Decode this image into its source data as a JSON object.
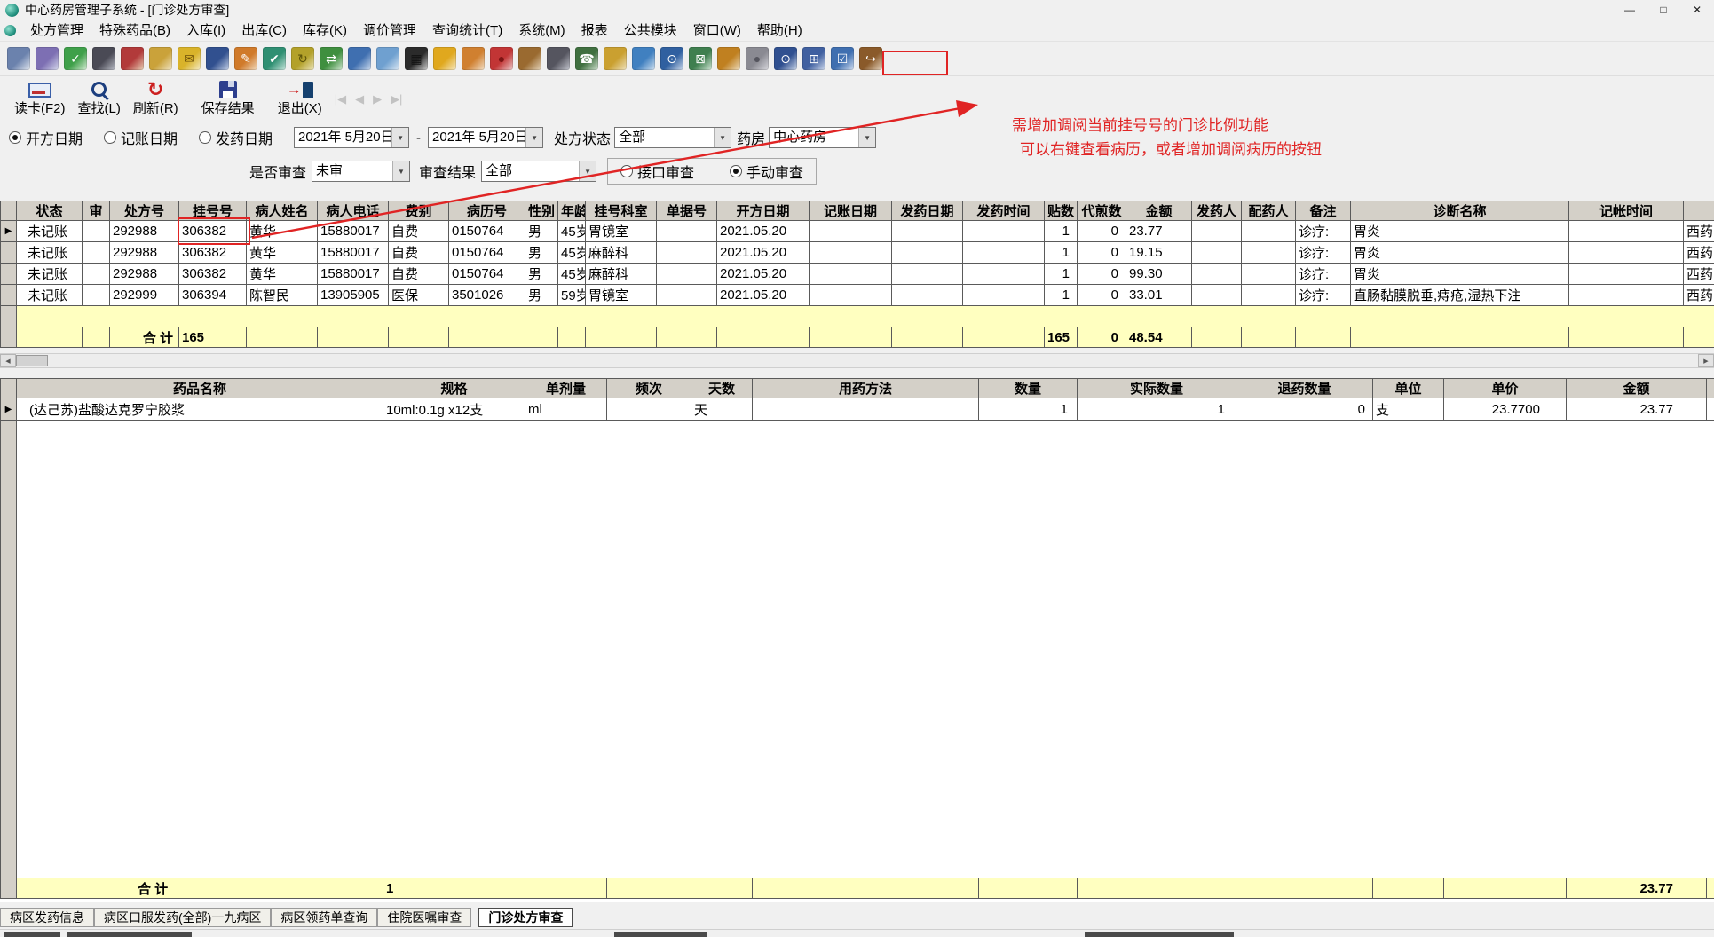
{
  "window": {
    "title": "中心药房管理子系统 - [门诊处方审查]",
    "controls": [
      {
        "name": "minimize-button",
        "glyph": "—"
      },
      {
        "name": "maximize-button",
        "glyph": "□"
      },
      {
        "name": "close-button",
        "glyph": "✕"
      }
    ]
  },
  "menu_items": [
    "处方管理",
    "特殊药品(B)",
    "入库(I)",
    "出库(C)",
    "库存(K)",
    "调价管理",
    "查询统计(T)",
    "系统(M)",
    "报表",
    "公共模块",
    "窗口(W)",
    "帮助(H)"
  ],
  "toolbar_icons": [
    {
      "name": "print-icon",
      "c1": "#6b82ad",
      "c2": "#e3e8f0",
      "g": ""
    },
    {
      "name": "print-preview-icon",
      "c1": "#7d6fb3",
      "c2": "#d6d9ec",
      "g": ""
    },
    {
      "name": "audit-check-icon",
      "c1": "#3fa04a",
      "c2": "#d6ecd6",
      "g": "✓",
      "fg": "#ffffff"
    },
    {
      "name": "binoculars-icon",
      "c1": "#4a4a55",
      "c2": "#bcbfc8",
      "g": ""
    },
    {
      "name": "register-book-icon",
      "c1": "#b23a3a",
      "c2": "#e8d2b8",
      "g": ""
    },
    {
      "name": "invoice-icon",
      "c1": "#caa23a",
      "c2": "#f1e6c8",
      "g": ""
    },
    {
      "name": "mail-icon",
      "c1": "#d9b32a",
      "c2": "#f5ecc9",
      "g": "✉",
      "fg": "#6b4e09"
    },
    {
      "name": "save-icon",
      "c1": "#31508f",
      "c2": "#c6d2e8",
      "g": ""
    },
    {
      "name": "edit-icon",
      "c1": "#d07a2a",
      "c2": "#f2ddc2",
      "g": "✎",
      "fg": "#ffffff"
    },
    {
      "name": "approve-icon",
      "c1": "#2f8f72",
      "c2": "#c9e6dd",
      "g": "✔",
      "fg": "#ffffff"
    },
    {
      "name": "recalc-icon",
      "c1": "#b3a12a",
      "c2": "#ece5bd",
      "g": "↻",
      "fg": "#5e5409"
    },
    {
      "name": "transfer-icon",
      "c1": "#3f8f3f",
      "c2": "#cfe6cf",
      "g": "⇄",
      "fg": "#ffffff"
    },
    {
      "name": "chart-icon",
      "c1": "#3f6fb0",
      "c2": "#cddbee",
      "g": ""
    },
    {
      "name": "report-icon",
      "c1": "#6fa0d0",
      "c2": "#dde9f4",
      "g": ""
    },
    {
      "name": "barcode-icon",
      "c1": "#2b2b2b",
      "c2": "#cfcfcf",
      "g": "▦",
      "fg": "#111111"
    },
    {
      "name": "bell-icon",
      "c1": "#e0a81e",
      "c2": "#f6e9c4",
      "g": ""
    },
    {
      "name": "schedule-icon",
      "c1": "#d08030",
      "c2": "#f2e0c8",
      "g": ""
    },
    {
      "name": "alert-icon",
      "c1": "#c23535",
      "c2": "#eccaca",
      "g": "●",
      "fg": "#7d1414"
    },
    {
      "name": "package-icon",
      "c1": "#9a6a30",
      "c2": "#e6d6bd",
      "g": ""
    },
    {
      "name": "search-record-icon",
      "c1": "#55555f",
      "c2": "#c4c6cf",
      "g": ""
    },
    {
      "name": "phone-icon",
      "c1": "#3f6f3f",
      "c2": "#cfe0cf",
      "g": "☎",
      "fg": "#ffffff"
    },
    {
      "name": "mailbox-icon",
      "c1": "#caa030",
      "c2": "#efe3c2",
      "g": ""
    },
    {
      "name": "thermometer-icon",
      "c1": "#4080c0",
      "c2": "#d2e2f1",
      "g": ""
    },
    {
      "name": "zoom-icon",
      "c1": "#3060a0",
      "c2": "#cfdcec",
      "g": "⊙",
      "fg": "#ffffff"
    },
    {
      "name": "close-grid-icon",
      "c1": "#3f7f4f",
      "c2": "#d2e6d7",
      "g": "⊠",
      "fg": "#ffffff"
    },
    {
      "name": "open-folder-icon",
      "c1": "#c08020",
      "c2": "#eedfc2",
      "g": ""
    },
    {
      "name": "sphere-icon",
      "c1": "#8a8a92",
      "c2": "#d9d9de",
      "g": "●",
      "fg": "#55555e"
    },
    {
      "name": "magnifier-icon",
      "c1": "#305090",
      "c2": "#ccd8ea",
      "g": "⊙",
      "fg": "#ffffff"
    },
    {
      "name": "window-list-icon",
      "c1": "#4060a0",
      "c2": "#d2dcee",
      "g": "⊞",
      "fg": "#ffffff"
    },
    {
      "name": "checklist-icon",
      "c1": "#3f6fb0",
      "c2": "#d2def0",
      "g": "☑",
      "fg": "#ffffff"
    },
    {
      "name": "exit-door-icon",
      "c1": "#8a5a2a",
      "c2": "#e6d5c0",
      "g": "↪",
      "fg": "#ffffff"
    }
  ],
  "record_nav": [
    {
      "name": "nav-first-icon",
      "glyph": "|◀"
    },
    {
      "name": "nav-prev-icon",
      "glyph": "◀"
    },
    {
      "name": "nav-next-icon",
      "glyph": "▶"
    },
    {
      "name": "nav-last-icon",
      "glyph": "▶|"
    }
  ],
  "action_buttons": [
    {
      "name": "read-card-button",
      "label": "读卡(F2)"
    },
    {
      "name": "find-button",
      "label": "查找(L)"
    },
    {
      "name": "refresh-button",
      "label": "刷新(R)"
    },
    {
      "name": "save-results-button",
      "label": "保存结果"
    },
    {
      "name": "exit-button",
      "label": "退出(X)"
    }
  ],
  "filters": {
    "date_radios": [
      {
        "label": "开方日期",
        "checked": true
      },
      {
        "label": "记账日期",
        "checked": false
      },
      {
        "label": "发药日期",
        "checked": false
      }
    ],
    "date_from": "2021年 5月20日",
    "date_separator": "-",
    "date_to": "2021年 5月20日",
    "status_label": "处方状态",
    "status_value": "全部",
    "pharmacy_label": "药房",
    "pharmacy_value": "中心药房",
    "review_label": "是否审查",
    "review_value": "未审",
    "result_label": "审查结果",
    "result_value": "全部",
    "mode_radios": [
      {
        "label": "接口审查",
        "checked": false
      },
      {
        "label": "手动审查",
        "checked": true
      }
    ]
  },
  "annotation": {
    "color": "#e02424",
    "line1": "需增加调阅当前挂号号的门诊比例功能",
    "line2": "可以右键查看病历，或者增加调阅病历的按钮"
  },
  "scrollbar": {
    "left": "◀",
    "right": "▶"
  },
  "prescription_grid": {
    "headers": [
      "状态",
      "审",
      "处方号",
      "挂号号",
      "病人姓名",
      "病人电话",
      "费别",
      "病历号",
      "性别",
      "年龄",
      "挂号科室",
      "单据号",
      "开方日期",
      "记账日期",
      "发药日期",
      "发药时间",
      "贴数",
      "代煎数",
      "金额",
      "发药人",
      "配药人",
      "备注",
      "诊断名称",
      "记帐时间",
      ""
    ],
    "rows": [
      [
        "未记账",
        "",
        "292988",
        "306382",
        "黄华",
        "15880017",
        "自费",
        "0150764",
        "男",
        "45岁",
        "胃镜室",
        "",
        "2021.05.20",
        "",
        "",
        "",
        "1",
        "0",
        "23.77",
        "",
        "",
        "诊疗:",
        "胃炎",
        "",
        "西药"
      ],
      [
        "未记账",
        "",
        "292988",
        "306382",
        "黄华",
        "15880017",
        "自费",
        "0150764",
        "男",
        "45岁",
        "麻醉科",
        "",
        "2021.05.20",
        "",
        "",
        "",
        "1",
        "0",
        "19.15",
        "",
        "",
        "诊疗:",
        "胃炎",
        "",
        "西药"
      ],
      [
        "未记账",
        "",
        "292988",
        "306382",
        "黄华",
        "15880017",
        "自费",
        "0150764",
        "男",
        "45岁",
        "麻醉科",
        "",
        "2021.05.20",
        "",
        "",
        "",
        "1",
        "0",
        "99.30",
        "",
        "",
        "诊疗:",
        "胃炎",
        "",
        "西药"
      ],
      [
        "未记账",
        "",
        "292999",
        "306394",
        "陈智民",
        "13905905",
        "医保",
        "3501026",
        "男",
        "59岁",
        "胃镜室",
        "",
        "2021.05.20",
        "",
        "",
        "",
        "1",
        "0",
        "33.01",
        "",
        "",
        "诊疗:",
        "直肠黏膜脱垂,痔疮,湿热下注",
        "",
        "西药"
      ]
    ],
    "total_row": [
      "",
      "",
      "合  计",
      "165",
      "",
      "",
      "",
      "",
      "",
      "",
      "",
      "",
      "",
      "",
      "",
      "",
      "165",
      "0",
      "48.54",
      "",
      "",
      "",
      "",
      "",
      ""
    ]
  },
  "drug_grid": {
    "headers": [
      "药品名称",
      "规格",
      "单剂量",
      "频次",
      "天数",
      "用药方法",
      "数量",
      "实际数量",
      "退药数量",
      "单位",
      "单价",
      "金额",
      ""
    ],
    "rows": [
      [
        "(达己苏)盐酸达克罗宁胶浆",
        "10ml:0.1g x12支",
        "ml",
        "",
        "天",
        "",
        "1",
        "1",
        "0",
        "支",
        "23.7700",
        "23.77",
        ""
      ]
    ],
    "total_row": [
      "合  计",
      "1",
      "",
      "",
      "",
      "",
      "",
      "",
      "",
      "",
      "",
      "23.77",
      ""
    ]
  },
  "tabs": [
    {
      "label": "病区发药信息",
      "active": false
    },
    {
      "label": "病区口服发药(全部)一九病区",
      "active": false
    },
    {
      "label": "病区领药单查询",
      "active": false
    },
    {
      "label": "住院医嘱审查",
      "active": false
    },
    {
      "label": "门诊处方审查",
      "active": true
    }
  ]
}
